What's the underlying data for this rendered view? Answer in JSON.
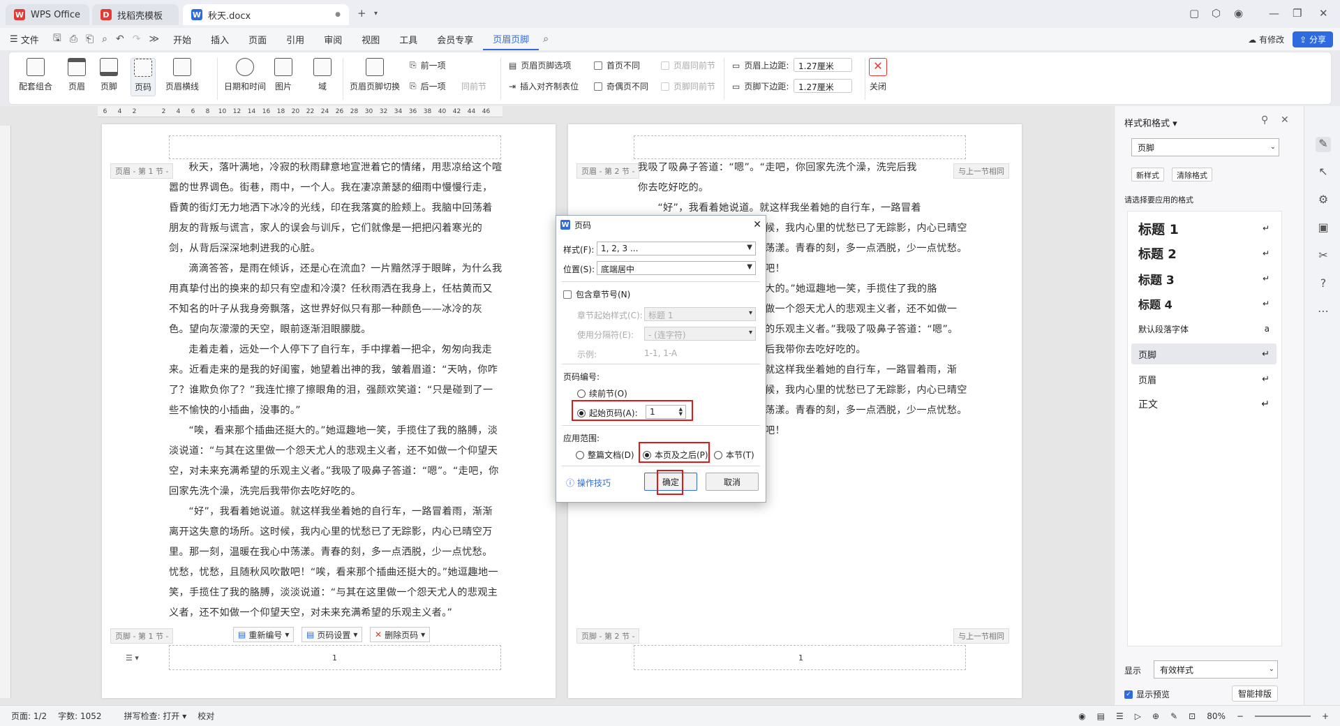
{
  "tabs": [
    {
      "label": "WPS Office",
      "active": false
    },
    {
      "label": "找稻壳模板",
      "active": false
    },
    {
      "label": "秋天.docx",
      "active": true
    }
  ],
  "menu": {
    "file": "文件",
    "items": [
      "开始",
      "插入",
      "页面",
      "引用",
      "审阅",
      "视图",
      "工具",
      "会员专享",
      "页眉页脚"
    ],
    "active": "页眉页脚",
    "modified": "有修改",
    "share": "分享"
  },
  "ribbon": {
    "big_buttons": [
      "配套组合",
      "页眉",
      "页脚",
      "页码",
      "页眉横线",
      "日期和时间",
      "图片",
      "域",
      "页眉页脚切换",
      "关闭"
    ],
    "prev": "前一项",
    "next": "后一项",
    "same_prev": "同前节",
    "options": "页眉页脚选项",
    "insert_align": "插入对齐制表位",
    "first_diff": "首页不同",
    "odd_even_diff": "奇偶页不同",
    "header_same_prev": "页眉同前节",
    "footer_same_prev": "页脚同前节",
    "top_margin_label": "页眉上边距:",
    "top_margin": "1.27厘米",
    "bottom_margin_label": "页脚下边距:",
    "bottom_margin": "1.27厘米"
  },
  "ruler_ticks": [
    "6",
    "4",
    "2",
    "",
    "2",
    "4",
    "6",
    "8",
    "10",
    "12",
    "14",
    "16",
    "18",
    "20",
    "22",
    "24",
    "26",
    "28",
    "30",
    "32",
    "34",
    "36",
    "38",
    "40",
    "42",
    "44",
    "46"
  ],
  "page1": {
    "header_label": "页眉 - 第 1 节 -",
    "footer_label": "页脚 - 第 1 节 -",
    "paragraphs": [
      "秋天，落叶满地，冷寂的秋雨肆意地宣泄着它的情绪，用悲凉给这个喧嚣的世界调色。街巷，雨中，一个人。我在凄凉萧瑟的细雨中慢慢行走，昏黄的街灯无力地洒下冰冷的光线，印在我落寞的脸颊上。我脑中回荡着朋友的背叛与谎言，家人的误会与训斥，它们就像是一把把闪着寒光的剑，从背后深深地刺进我的心脏。",
      "滴滴答答，是雨在倾诉，还是心在流血？一片黯然浮于眼眸，为什么我用真挚付出的换来的却只有空虚和冷漠？任秋雨洒在我身上，任枯黄而又不知名的叶子从我身旁飘落，这世界好似只有那一种颜色——冰冷的灰色。望向灰濛濛的天空，眼前逐渐泪眼朦胧。",
      "走着走着，远处一个人停下了自行车，手中撑着一把伞，匆匆向我走来。近看走来的是我的好闺蜜，她望着出神的我，皱着眉道：“天呐，你咋了？谁欺负你了？”我连忙擦了擦眼角的泪，强颜欢笑道：“只是碰到了一些不愉快的小插曲，没事的。”",
      "“唉，看来那个插曲还挺大的。”她逗趣地一笑，手揽住了我的胳膊，淡淡说道：“与其在这里做一个怨天尤人的悲观主义者，还不如做一个仰望天空，对未来充满希望的乐观主义者。”我吸了吸鼻子答道：“嗯”。“走吧，你回家先洗个澡，洗完后我带你去吃好吃的。",
      "“好”，我看着她说道。就这样我坐着她的自行车，一路冒着雨，渐渐离开这失意的场所。这时候，我内心里的忧愁已了无踪影，内心已晴空万里。那一刻，温暖在我心中荡漾。青春的刻，多一点洒脱，少一点忧愁。忧愁，忧愁，且随秋风吹散吧！“唉，看来那个插曲还挺大的。”她逗趣地一笑，手揽住了我的胳膊，淡淡说道：“与其在这里做一个怨天尤人的悲观主义者，还不如做一个仰望天空，对未来充满希望的乐观主义者。”"
    ],
    "page_number": "1"
  },
  "footer_tools": {
    "renumber": "重新编号",
    "page_setup": "页码设置",
    "delete": "删除页码"
  },
  "page2": {
    "header_label": "页眉 - 第 2 节 -",
    "same_as_prev": "与上一节相同",
    "footer_label": "页脚 - 第 2 节 -",
    "lines": [
      "我吸了吸鼻子答道：“嗯”。“走吧，你回家先洗个澡，洗完后我",
      "你去吃好吃的。",
      "“好”，我看着她说道。就这样我坐着她的自行车，一路冒着雨，渐",
      "候，我内心里的忧愁已了无踪影，内心已晴空",
      "荡漾。青春的刻，多一点洒脱，少一点忧愁。",
      "吧！",
      "大的。”她逗趣地一笑，手揽住了我的胳",
      "做一个怨天尤人的悲观主义者，还不如做一",
      "的乐观主义者。”我吸了吸鼻子答道：“嗯”。",
      "后我带你去吃好吃的。",
      "就这样我坐着她的自行车，一路冒着雨，渐",
      "候，我内心里的忧愁已了无踪影，内心已晴空",
      "荡漾。青春的刻，多一点洒脱，少一点忧愁。",
      "吧！"
    ],
    "page_number": "1"
  },
  "dialog": {
    "title": "页码",
    "style_label": "样式(F):",
    "style_value": "1, 2, 3 ...",
    "position_label": "位置(S):",
    "position_value": "底端居中",
    "include_chapter": "包含章节号(N)",
    "chapter_style_label": "章节起始样式(C):",
    "chapter_style_value": "标题 1",
    "separator_label": "使用分隔符(E):",
    "separator_value": "-  (连字符)",
    "example_label": "示例:",
    "example_value": "1-1, 1-A",
    "numbering_label": "页码编号:",
    "continue": "续前节(O)",
    "start_at": "起始页码(A):",
    "start_value": "1",
    "apply_label": "应用范围:",
    "whole_doc": "整篇文档(D)",
    "this_and_after": "本页及之后(P)",
    "this_section": "本节(T)",
    "tips": "操作技巧",
    "ok": "确定",
    "cancel": "取消"
  },
  "panel": {
    "title": "样式和格式",
    "current": "页脚",
    "new_style": "新样式",
    "clear_format": "清除格式",
    "prompt": "请选择要应用的格式",
    "styles": [
      "标题 1",
      "标题 2",
      "标题 3",
      "标题 4",
      "默认段落字体",
      "页脚",
      "页眉",
      "正文"
    ],
    "show_label": "显示",
    "show_value": "有效样式",
    "preview": "显示预览",
    "smart": "智能排版"
  },
  "status": {
    "page": "页面: 1/2",
    "words": "字数: 1052",
    "spell": "拼写检查: 打开",
    "proof": "校对",
    "zoom": "80%"
  },
  "colors": {
    "accent": "#2f6bde",
    "highlight": "#e01818",
    "wps_red": "#e53935"
  }
}
